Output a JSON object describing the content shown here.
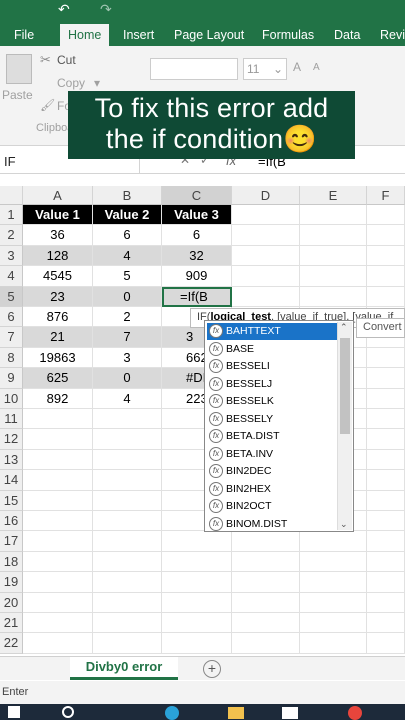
{
  "ribbon": {
    "tabs": [
      "File",
      "Home",
      "Insert",
      "Page Layout",
      "Formulas",
      "Data",
      "Revi"
    ],
    "active_tab": "Home",
    "cut_label": "Cut",
    "copy_label": "Copy",
    "paste_label": "Paste",
    "format_label": "Fo",
    "clipboard_label": "Clipboard",
    "font_size": "11"
  },
  "caption": {
    "line1": "To fix this error add",
    "line2": "the if condition😊"
  },
  "formula_bar": {
    "name_box": "IF",
    "fx_symbol": "fx",
    "formula": "=If(B"
  },
  "columns": [
    "A",
    "B",
    "C",
    "D",
    "E",
    "F"
  ],
  "rows": [
    "1",
    "2",
    "3",
    "4",
    "5",
    "6",
    "7",
    "8",
    "9",
    "10",
    "11",
    "12",
    "13",
    "14",
    "15",
    "16",
    "17",
    "18",
    "19",
    "20",
    "21",
    "22"
  ],
  "table": {
    "headers": [
      "Value 1",
      "Value 2",
      "Value 3"
    ],
    "data": [
      [
        "36",
        "6",
        "6"
      ],
      [
        "128",
        "4",
        "32"
      ],
      [
        "4545",
        "5",
        "909"
      ],
      [
        "23",
        "0",
        "=If(B"
      ],
      [
        "876",
        "2",
        "2"
      ],
      [
        "21",
        "7",
        "3"
      ],
      [
        "19863",
        "3",
        "662"
      ],
      [
        "625",
        "0",
        "#DIV/"
      ],
      [
        "892",
        "4",
        "223"
      ]
    ]
  },
  "autocomplete": {
    "tooltip": "IF(logical_test, [value_if_true], [value_if",
    "tooltip_bold": "logical_test",
    "side_tip": "Convert",
    "functions": [
      "BAHTTEXT",
      "BASE",
      "BESSELI",
      "BESSELJ",
      "BESSELK",
      "BESSELY",
      "BETA.DIST",
      "BETA.INV",
      "BIN2DEC",
      "BIN2HEX",
      "BIN2OCT",
      "BINOM.DIST"
    ]
  },
  "sheet": {
    "tab_name": "Divby0 error",
    "add_sheet": "+"
  },
  "status": {
    "mode": "Enter"
  },
  "colors": {
    "excel_green": "#217346",
    "header_black": "#000000",
    "highlight_blue": "#1a73c8"
  }
}
